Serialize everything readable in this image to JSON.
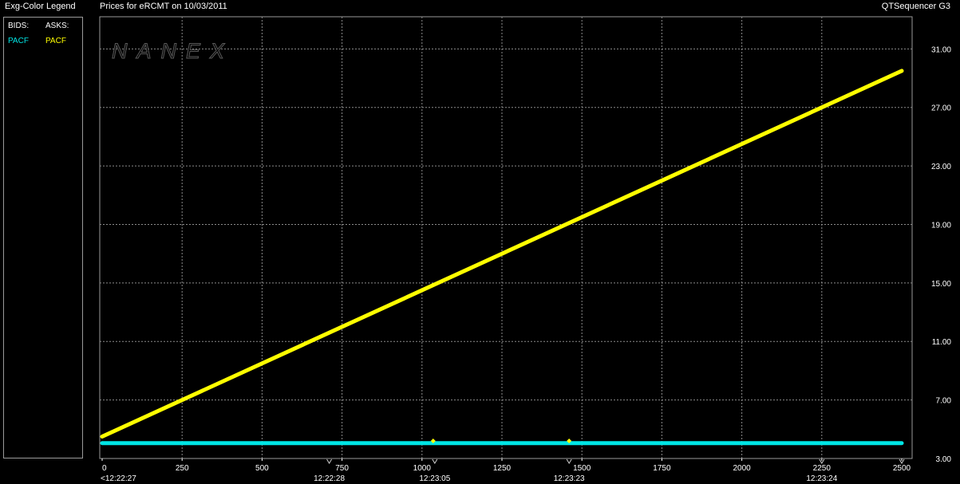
{
  "header": {
    "legend_title": "Exg-Color Legend",
    "chart_title": "Prices for  eRCMT  on  10/03/2011",
    "app_name": "QTSequencer G3"
  },
  "legend": {
    "bids_label": "BIDS:",
    "asks_label": "ASKS:",
    "bids_exchange": "PACF",
    "asks_exchange": "PACF"
  },
  "watermark": "NANEX",
  "colors": {
    "bid": "#00e5e5",
    "ask": "#ffff00",
    "grid": "#8a8a8a"
  },
  "chart_data": {
    "type": "line",
    "title": "Prices for  eRCMT  on  10/03/2011",
    "x_ticks": [
      0,
      250,
      500,
      750,
      1000,
      1250,
      1500,
      1750,
      2000,
      2250,
      2500
    ],
    "x_tick_labels": [
      "0",
      "250",
      "500",
      "750",
      "1000",
      "1250",
      "1500",
      "1750",
      "2000",
      "2250",
      "2500"
    ],
    "time_labels": [
      {
        "x": 0,
        "label": "<12:22:27"
      },
      {
        "x": 710,
        "label": "12:22:28"
      },
      {
        "x": 1040,
        "label": "12:23:05"
      },
      {
        "x": 1460,
        "label": "12:23:23"
      },
      {
        "x": 2250,
        "label": "12:23:24"
      }
    ],
    "y_ticks": [
      3.0,
      7.0,
      11.0,
      15.0,
      19.0,
      23.0,
      27.0,
      31.0
    ],
    "y_tick_labels": [
      "3.00",
      "7.00",
      "11.00",
      "15.00",
      "19.00",
      "23.00",
      "27.00",
      "31.00"
    ],
    "xlim": [
      0,
      2500
    ],
    "ylim": [
      3.0,
      32.0
    ],
    "grid": true,
    "series": [
      {
        "name": "ASKS: PACF",
        "color": "#ffff00",
        "x": [
          0,
          2500
        ],
        "y": [
          4.5,
          29.5
        ]
      },
      {
        "name": "BIDS: PACF",
        "color": "#00e5e5",
        "x": [
          0,
          2500
        ],
        "y": [
          4.05,
          4.05
        ]
      }
    ],
    "markers": [
      {
        "x": 1035,
        "y": 4.2
      },
      {
        "x": 1460,
        "y": 4.2
      }
    ]
  }
}
